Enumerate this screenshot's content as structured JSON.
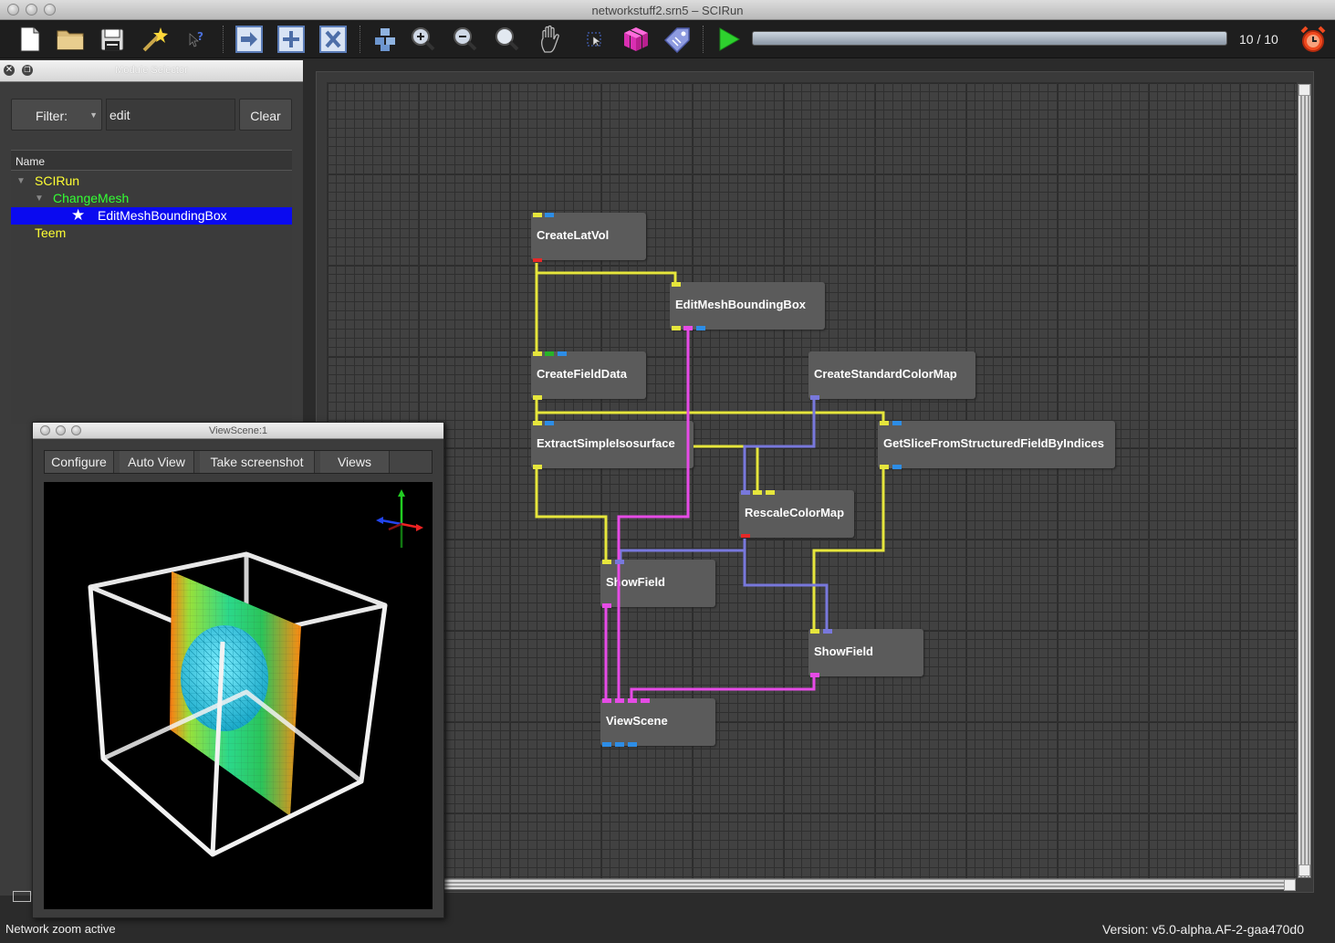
{
  "window": {
    "title": "networkstuff2.srn5 – SCIRun"
  },
  "toolbar": {
    "icons": [
      "new-file-icon",
      "open-folder-icon",
      "save-icon",
      "wizard-icon",
      "whats-this-icon",
      "execute-selected-icon",
      "add-icon",
      "clear-icon",
      "layout-icon",
      "zoom-in-icon",
      "zoom-out-icon",
      "zoom-reset-icon",
      "hand-icon",
      "pointer-icon",
      "cube-icon",
      "tag-icon",
      "play-icon",
      "alarm-icon"
    ],
    "progress": 1.0,
    "progress_label": "10 / 10"
  },
  "module_selector": {
    "title": "Module Selector",
    "filter_label": "Filter:",
    "filter_value": "edit",
    "clear_label": "Clear",
    "column_name": "Name",
    "tree": [
      {
        "label": "SCIRun",
        "color": "#ffff33"
      },
      {
        "label": "ChangeMesh",
        "color": "#33ff33"
      },
      {
        "label": "EditMeshBoundingBox",
        "color": "#ffffff"
      },
      {
        "label": "Teem",
        "color": "#ffff33"
      }
    ]
  },
  "network": {
    "modules": [
      {
        "name": "CreateLatVol"
      },
      {
        "name": "EditMeshBoundingBox"
      },
      {
        "name": "CreateFieldData"
      },
      {
        "name": "CreateStandardColorMap"
      },
      {
        "name": "ExtractSimpleIsosurface"
      },
      {
        "name": "GetSliceFromStructuredFieldByIndices"
      },
      {
        "name": "RescaleColorMap"
      },
      {
        "name": "ShowField"
      },
      {
        "name": "ShowField"
      },
      {
        "name": "ViewScene"
      }
    ],
    "port_colors": {
      "field": "#e6e63c",
      "matrix": "#2d8de6",
      "colormap": "#7878dc",
      "geometry": "#e64be6",
      "string": "#28b428",
      "error": "#e62828"
    }
  },
  "viewscene": {
    "title": "ViewScene:1",
    "buttons": [
      "Configure",
      "Auto View",
      "Take screenshot",
      "Views"
    ]
  },
  "status": {
    "left": "Network zoom active",
    "version": "Version: v5.0-alpha.AF-2-gaa470d0"
  }
}
